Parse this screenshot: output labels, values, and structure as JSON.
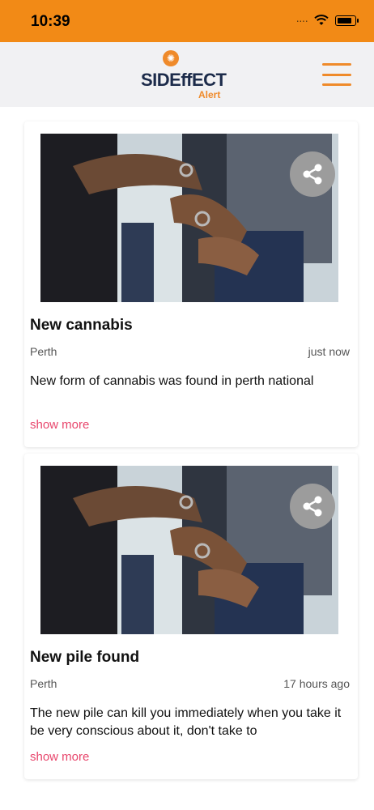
{
  "status_bar": {
    "time": "10:39",
    "background": "#f28a16"
  },
  "header": {
    "logo_text": "SIDEffECT",
    "logo_sub": "Alert",
    "menu_icon": "hamburger-icon",
    "accent": "#ef8a2a"
  },
  "posts": [
    {
      "title": "New cannabis",
      "location": "Perth",
      "time": "just now",
      "description": "New form of cannabis was found in perth national",
      "more": "show more",
      "share_icon": "share-icon"
    },
    {
      "title": "New pile found",
      "location": "Perth",
      "time": "17 hours ago",
      "description": "The new pile can kill you immediately when you take it be very conscious about it, don't take to",
      "more": "show more",
      "share_icon": "share-icon"
    }
  ],
  "colors": {
    "link": "#e8466c",
    "header_bg": "#f1f1f3"
  }
}
